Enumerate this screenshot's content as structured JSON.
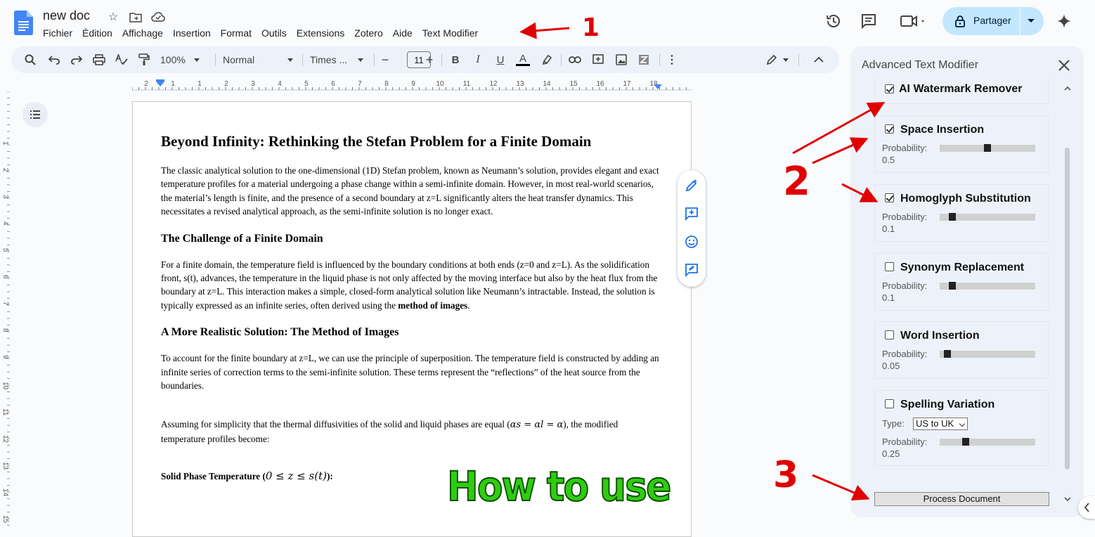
{
  "doc": {
    "title": "new doc"
  },
  "menu": [
    "Fichier",
    "Édition",
    "Affichage",
    "Insertion",
    "Format",
    "Outils",
    "Extensions",
    "Zotero",
    "Aide",
    "Text Modifier"
  ],
  "share": {
    "label": "Partager"
  },
  "toolbar": {
    "zoom": "100%",
    "style": "Normal",
    "font": "Times ...",
    "font_size": "11"
  },
  "ruler_labels": [
    "2",
    "1",
    "1",
    "2",
    "3",
    "4",
    "5",
    "6",
    "7",
    "8",
    "9",
    "10",
    "11",
    "12",
    "13",
    "14",
    "15",
    "16",
    "17",
    "18"
  ],
  "vruler_labels": [
    "1",
    "2",
    "3",
    "4",
    "5",
    "6",
    "7",
    "8",
    "9",
    "10",
    "11",
    "12",
    "13",
    "14",
    "15"
  ],
  "document": {
    "heading": "Beyond Infinity: Rethinking the Stefan Problem for a Finite Domain",
    "p1": "The classic analytical solution to the one-dimensional (1D) Stefan problem, known as Neumann’s solution, provides elegant and exact temperature profiles for a material undergoing a phase change within a semi-infinite domain. However, in most real-world scenarios, the material’s length is finite, and the presence of a second boundary at z=L significantly alters the heat transfer dynamics. This necessitates a revised analytical approach, as the semi-infinite solution is no longer exact.",
    "h2a": "The Challenge of a Finite Domain",
    "p2": "For a finite domain, the temperature field is influenced by the boundary conditions at both ends (z=0 and z=L). As the solidification front, s(t), advances, the temperature in the liquid phase is not only affected by the moving interface but also by the heat flux from the boundary at z=L. This interaction makes a simple, closed-form analytical solution like Neumann’s intractable. Instead, the solution is typically expressed as an infinite series, often derived using the ",
    "p2_bold": "method of images",
    "p2_end": ".",
    "h2b": "A More Realistic Solution: The Method of Images",
    "p3": "To account for the finite boundary at z=L, we can use the principle of superposition. The temperature field is constructed by adding an infinite series of correction terms to the semi-infinite solution. These terms represent the “reflections” of the heat source from the boundaries.",
    "p4_start": "Assuming for simplicity that the thermal diffusivities of the solid and liquid phases are equal (",
    "p4_math": "αs = αl = α",
    "p4_end": "), the modified temperature profiles become:",
    "solid_label": "Solid Phase Temperature (",
    "solid_math": "0 ≤ z ≤ s(t)",
    "solid_end": "):"
  },
  "overlay": {
    "howto": "How to use"
  },
  "annotations": {
    "one": "1",
    "two": "2",
    "three": "3"
  },
  "sidebar": {
    "title": "Advanced Text Modifier",
    "prob_label": "Probability:",
    "type_label": "Type:",
    "features": [
      {
        "name": "AI Watermark Remover",
        "checked": true
      },
      {
        "name": "Space Insertion",
        "checked": true,
        "probability": "0.5"
      },
      {
        "name": "Homoglyph Substitution",
        "checked": true,
        "probability": "0.1"
      },
      {
        "name": "Synonym Replacement",
        "checked": false,
        "probability": "0.1"
      },
      {
        "name": "Word Insertion",
        "checked": false,
        "probability": "0.05"
      },
      {
        "name": "Spelling Variation",
        "checked": false,
        "probability": "0.25",
        "type": "US to UK"
      }
    ],
    "process_label": "Process Document"
  },
  "colors": {
    "accent": "#c2e7ff",
    "annotation": "#e00000",
    "howto_fill": "#2fcc10"
  }
}
